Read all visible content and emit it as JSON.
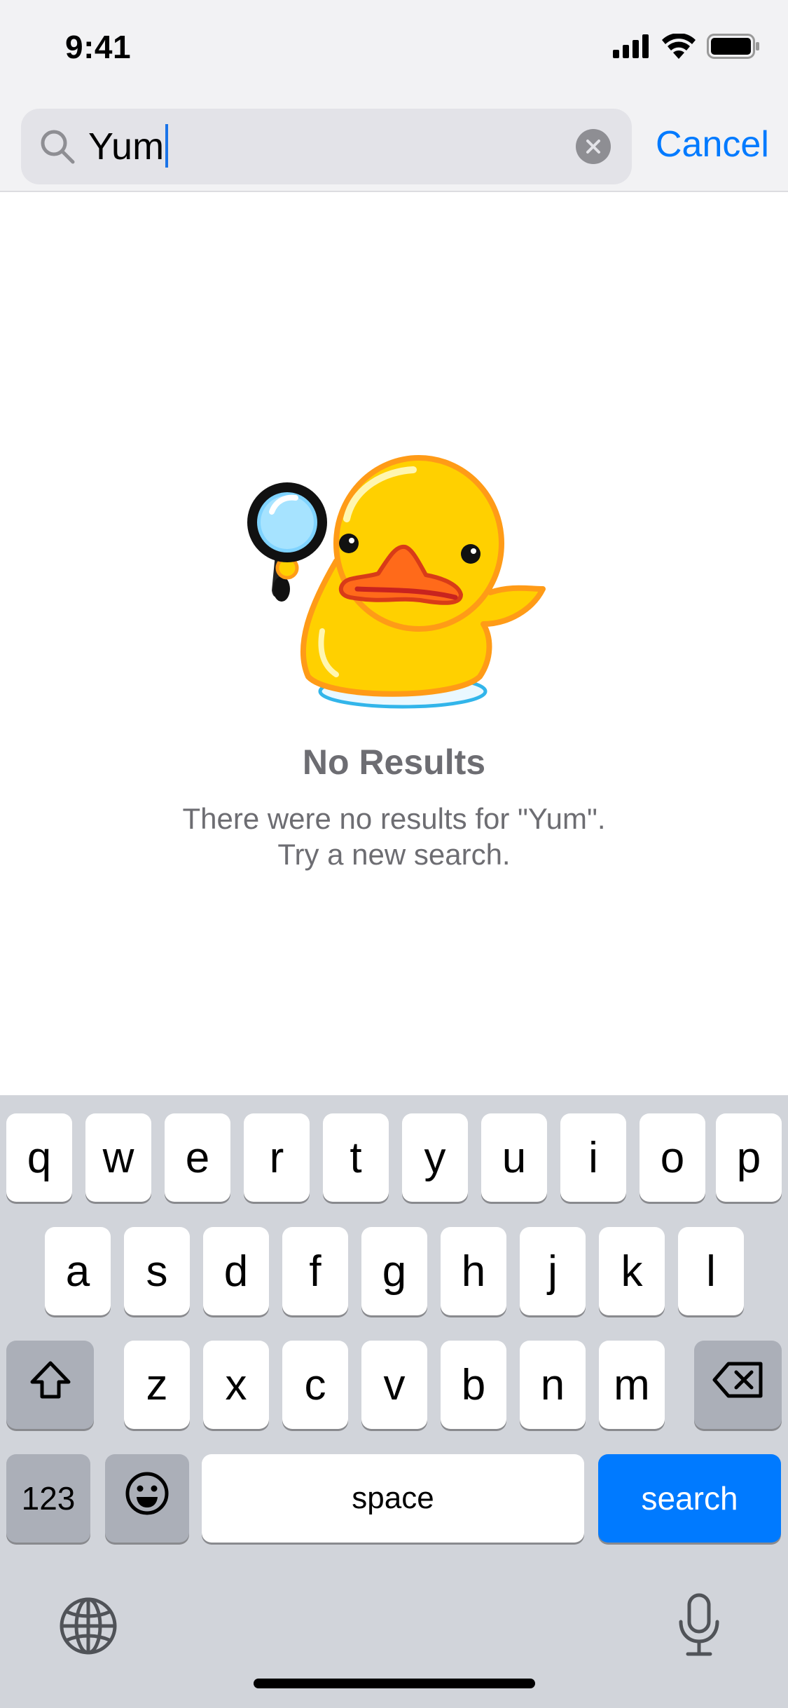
{
  "status_bar": {
    "time": "9:41"
  },
  "search": {
    "query": "Yum",
    "cancel_label": "Cancel"
  },
  "empty_state": {
    "title": "No Results",
    "message_line1": "There were no results for \"Yum\".",
    "message_line2": "Try a new search."
  },
  "keyboard": {
    "row1": [
      "q",
      "w",
      "e",
      "r",
      "t",
      "y",
      "u",
      "i",
      "o",
      "p"
    ],
    "row2": [
      "a",
      "s",
      "d",
      "f",
      "g",
      "h",
      "j",
      "k",
      "l"
    ],
    "row3": [
      "z",
      "x",
      "c",
      "v",
      "b",
      "n",
      "m"
    ],
    "numbers_label": "123",
    "space_label": "space",
    "search_label": "search"
  },
  "colors": {
    "accent": "#007aff",
    "keyboard_bg": "#d1d4da",
    "muted_text": "#6d6d72"
  },
  "icons": [
    "signal-icon",
    "wifi-icon",
    "battery-icon",
    "search-icon",
    "clear-icon",
    "duck-magnifier-sticker",
    "shift-icon",
    "backspace-icon",
    "emoji-icon",
    "globe-icon",
    "microphone-icon"
  ]
}
